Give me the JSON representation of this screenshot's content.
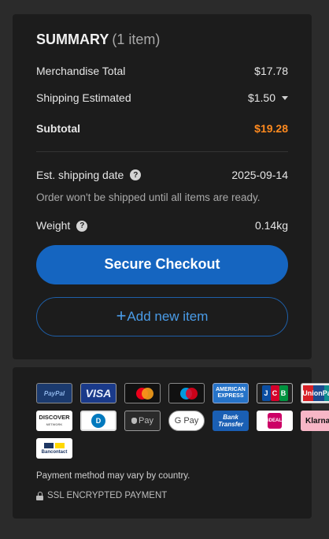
{
  "summary": {
    "title": "SUMMARY",
    "count": "(1 item)",
    "merchandise_label": "Merchandise Total",
    "merchandise_value": "$17.78",
    "shipping_label": "Shipping Estimated",
    "shipping_value": "$1.50",
    "subtotal_label": "Subtotal",
    "subtotal_value": "$19.28",
    "ship_date_label": "Est. shipping date",
    "ship_date_value": "2025-09-14",
    "ship_note": "Order won't be shipped until all items are ready.",
    "weight_label": "Weight",
    "weight_value": "0.14kg",
    "help_glyph": "?"
  },
  "buttons": {
    "checkout": "Secure Checkout",
    "add_plus": "+",
    "add_label": "Add new item"
  },
  "payment": {
    "logos": {
      "paypal": "PayPal",
      "visa": "VISA",
      "amex_1": "AMERICAN",
      "amex_2": "EXPRESS",
      "jcb_j": "J",
      "jcb_c": "C",
      "jcb_b": "B",
      "union": "UnionPay",
      "union_cn": "银联",
      "discover": "DISCOVER",
      "discover_sub": "NETWORK",
      "diners": "D",
      "apple": "Pay",
      "gpay": "G Pay",
      "bank_1": "Bank",
      "bank_2": "Transfer",
      "ideal": "iDEAL",
      "klarna": "Klarna.",
      "bancontact": "Bancontact"
    },
    "note": "Payment method may vary by country.",
    "ssl": "SSL ENCRYPTED PAYMENT"
  },
  "colors": {
    "accent": "#1565c0",
    "subtotal": "#ff8a1f",
    "link": "#4a9ce8"
  }
}
